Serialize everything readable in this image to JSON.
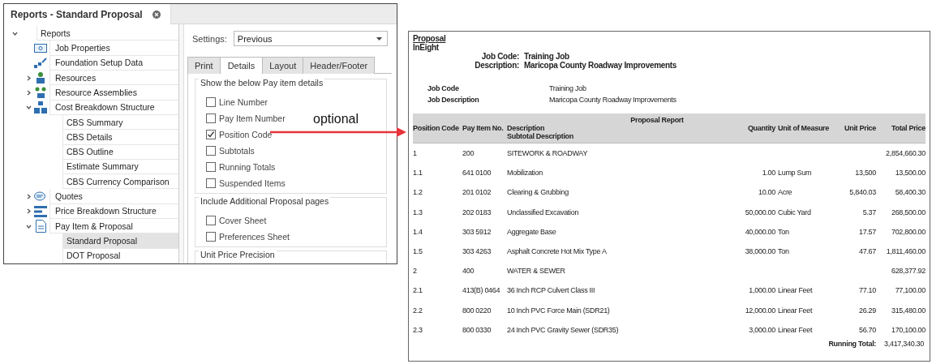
{
  "window": {
    "title": "Reports - Standard Proposal"
  },
  "tree": {
    "root": {
      "label": "Reports",
      "expanded": true,
      "selected": false
    },
    "items": [
      {
        "label": "Job Properties",
        "selected": false
      },
      {
        "label": "Foundation Setup Data",
        "selected": false
      },
      {
        "label": "Resources",
        "expanded": false,
        "selected": false
      },
      {
        "label": "Resource Assemblies",
        "expanded": false,
        "selected": false
      },
      {
        "label": "Cost Breakdown Structure",
        "expanded": true,
        "selected": false,
        "children": [
          {
            "label": "CBS Summary",
            "selected": false
          },
          {
            "label": "CBS Details",
            "selected": false
          },
          {
            "label": "CBS Outline",
            "selected": false
          },
          {
            "label": "Estimate Summary",
            "selected": false
          },
          {
            "label": "CBS Currency Comparison",
            "selected": false
          }
        ]
      },
      {
        "label": "Quotes",
        "expanded": false,
        "selected": false
      },
      {
        "label": "Price Breakdown Structure",
        "expanded": false,
        "selected": false
      },
      {
        "label": "Pay Item & Proposal",
        "expanded": true,
        "selected": false,
        "children": [
          {
            "label": "Standard Proposal",
            "selected": true
          },
          {
            "label": "DOT Proposal",
            "selected": false
          }
        ]
      }
    ]
  },
  "settings": {
    "label": "Settings:",
    "value": "Previous"
  },
  "tabs": [
    {
      "label": "Print",
      "selected": false
    },
    {
      "label": "Details",
      "selected": true
    },
    {
      "label": "Layout",
      "selected": false
    },
    {
      "label": "Header/Footer",
      "selected": false
    }
  ],
  "groups": [
    {
      "title": "Show the below Pay item details",
      "options": [
        {
          "label": "Line Number",
          "checked": false
        },
        {
          "label": "Pay Item Number",
          "checked": false
        },
        {
          "label": "Position Code",
          "checked": true
        },
        {
          "label": "Subtotals",
          "checked": false
        },
        {
          "label": "Running Totals",
          "checked": false
        },
        {
          "label": "Suspended Items",
          "checked": false
        }
      ]
    },
    {
      "title": "Include Additional Proposal pages",
      "options": [
        {
          "label": "Cover Sheet",
          "checked": false
        },
        {
          "label": "Preferences Sheet",
          "checked": false
        }
      ]
    },
    {
      "title": "Unit Price Precision"
    }
  ],
  "annotation": {
    "label": "optional"
  },
  "report": {
    "title": "Proposal",
    "company": "InEight",
    "header_fields": [
      {
        "label": "Job Code:",
        "value": "Training Job"
      },
      {
        "label": "Description:",
        "value": "Maricopa County Roadway Improvements"
      }
    ],
    "info_fields": [
      {
        "label": "Job Code",
        "value": "Training Job"
      },
      {
        "label": "Job Description",
        "value": "Maricopa County Roadway Improvements"
      }
    ],
    "table": {
      "caption": "Proposal Report",
      "columns": [
        "Position Code",
        "Pay Item No.",
        "Description",
        "Quantity",
        "Unit of Measure",
        "Unit Price",
        "Total Price"
      ],
      "subheader": "Subtotal Description",
      "rows": [
        {
          "cells": [
            "1",
            "200",
            "SITEWORK & ROADWAY",
            "",
            "",
            "",
            "2,854,660.30"
          ]
        },
        {
          "cells": [
            "1.1",
            "641 0100",
            "Mobilization",
            "1.00",
            "Lump Sum",
            "13,500",
            "13,500.00"
          ]
        },
        {
          "cells": [
            "1.2",
            "201 0102",
            "Clearing & Grubbing",
            "10.00",
            "Acre",
            "5,840.03",
            "58,400.30"
          ]
        },
        {
          "cells": [
            "1.3",
            "202 0183",
            "Unclassified Excavation",
            "50,000.00",
            "Cubic Yard",
            "5.37",
            "268,500.00"
          ]
        },
        {
          "cells": [
            "1.4",
            "303 5912",
            "Aggregate Base",
            "40,000.00",
            "Ton",
            "17.57",
            "702,800.00"
          ]
        },
        {
          "cells": [
            "1.5",
            "303 4263",
            "Asphalt Concrete Hot Mix Type A",
            "38,000.00",
            "Ton",
            "47.67",
            "1,811,460.00"
          ]
        },
        {
          "cells": [
            "2",
            "400",
            "WATER & SEWER",
            "",
            "",
            "",
            "628,377.92"
          ]
        },
        {
          "cells": [
            "2.1",
            "413(B) 0464",
            "36 Inch RCP Culvert Class III",
            "1,000.00",
            "Linear Feet",
            "77.10",
            "77,100.00"
          ]
        },
        {
          "cells": [
            "2.2",
            "800 0220",
            "10 Inch PVC Force Main (SDR21)",
            "12,000.00",
            "Linear Feet",
            "26.29",
            "315,480.00"
          ]
        },
        {
          "cells": [
            "2.3",
            "800 0330",
            "24 Inch PVC Gravity Sewer (SDR35)",
            "3,000.00",
            "Linear Feet",
            "56.70",
            "170,100.00"
          ]
        }
      ],
      "running_total": {
        "label": "Running Total:",
        "value": "3,417,340.30"
      }
    }
  }
}
